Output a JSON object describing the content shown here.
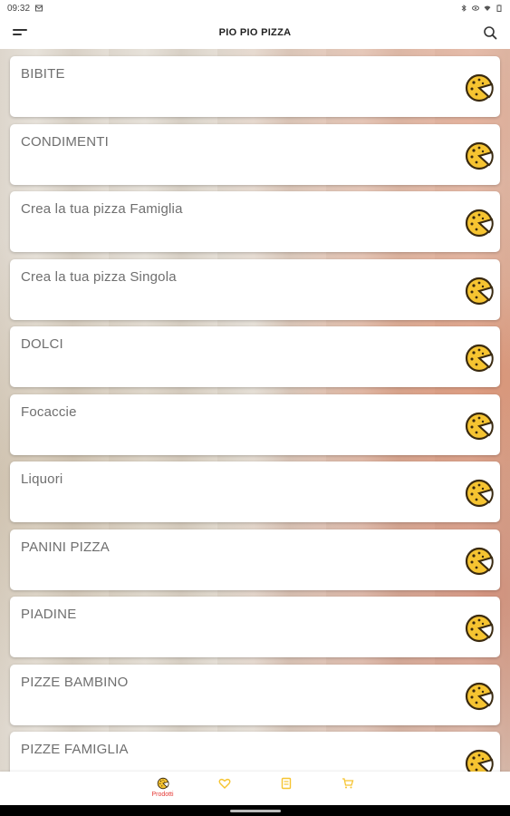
{
  "status_bar": {
    "time": "09:32"
  },
  "app_bar": {
    "title": "PIO PIO PIZZA"
  },
  "categories": [
    {
      "label": "BIBITE"
    },
    {
      "label": "CONDIMENTI"
    },
    {
      "label": "Crea la tua pizza Famiglia"
    },
    {
      "label": "Crea la tua pizza Singola"
    },
    {
      "label": "DOLCI"
    },
    {
      "label": "Focaccie"
    },
    {
      "label": "Liquori"
    },
    {
      "label": "PANINI PIZZA"
    },
    {
      "label": "PIADINE"
    },
    {
      "label": "PIZZE BAMBINO"
    },
    {
      "label": "PIZZE FAMIGLIA"
    }
  ],
  "bottom_nav": {
    "tabs": [
      {
        "label": "Prodotti",
        "icon": "pizza-icon",
        "active": true
      },
      {
        "label": "",
        "icon": "heart-icon",
        "active": false
      },
      {
        "label": "",
        "icon": "receipt-icon",
        "active": false
      },
      {
        "label": "",
        "icon": "cart-icon",
        "active": false
      }
    ]
  },
  "colors": {
    "accent": "#e53935",
    "pizza_yellow": "#f6c431",
    "pizza_outline": "#3a2a10",
    "text_gray": "#6f6f6f"
  }
}
